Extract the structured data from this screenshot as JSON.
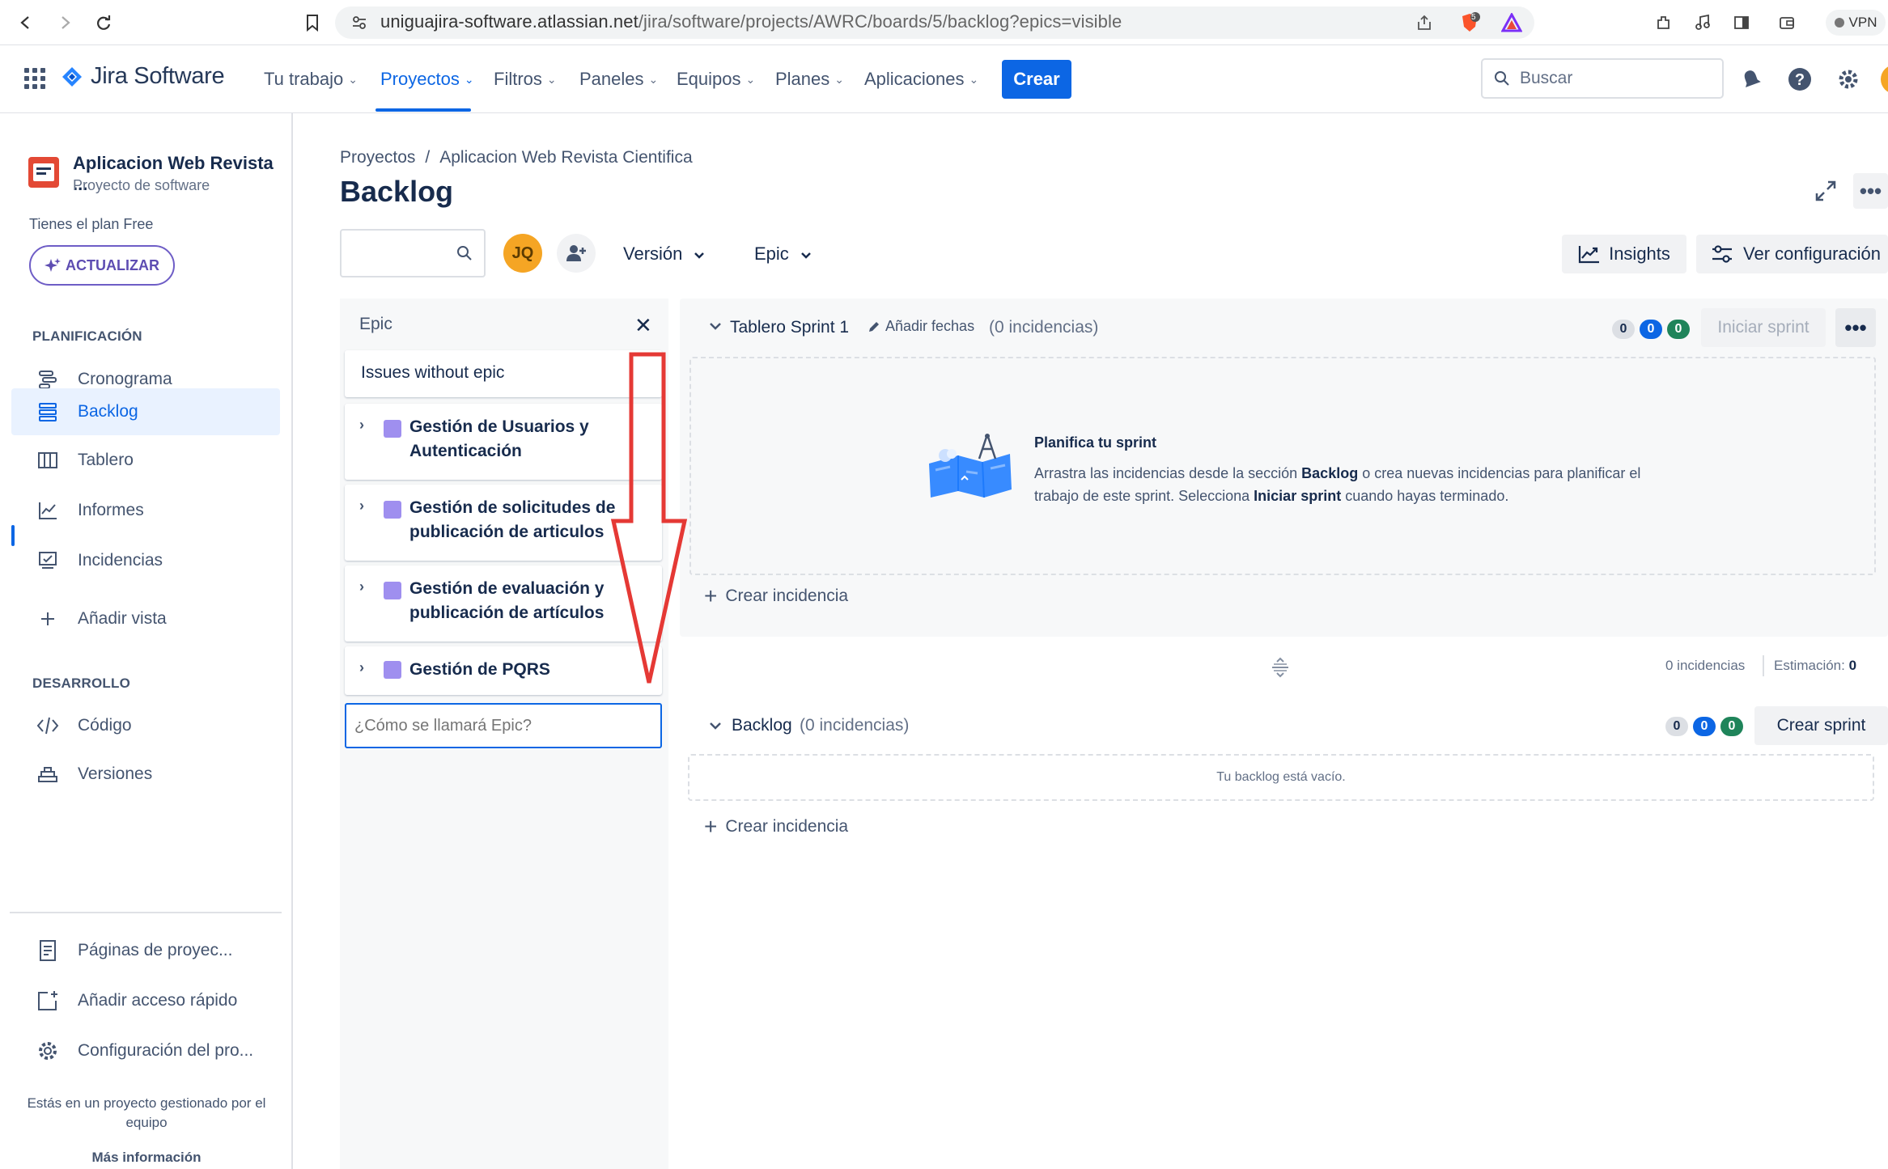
{
  "browser": {
    "url_domain": "uniguajira-software.atlassian.net",
    "url_path": "/jira/software/projects/AWRC/boards/5/backlog?epics=visible",
    "shield_badge": "5",
    "vpn_label": "VPN"
  },
  "topnav": {
    "product": "Jira Software",
    "items": [
      {
        "label": "Tu trabajo"
      },
      {
        "label": "Proyectos"
      },
      {
        "label": "Filtros"
      },
      {
        "label": "Paneles"
      },
      {
        "label": "Equipos"
      },
      {
        "label": "Planes"
      },
      {
        "label": "Aplicaciones"
      }
    ],
    "active_item": "Proyectos",
    "create_label": "Crear",
    "search_placeholder": "Buscar",
    "accent": "#0c66e4"
  },
  "sidebar": {
    "project_name": "Aplicacion Web Revista ...",
    "project_type": "Proyecto de software",
    "plan_text": "Tienes el plan Free",
    "upgrade_label": "ACTUALIZAR",
    "planning_section": "PLANIFICACIÓN",
    "planning_items": [
      {
        "label": "Cronograma",
        "icon": "timeline-icon"
      },
      {
        "label": "Backlog",
        "icon": "backlog-icon"
      },
      {
        "label": "Tablero",
        "icon": "board-icon"
      },
      {
        "label": "Informes",
        "icon": "reports-icon"
      },
      {
        "label": "Incidencias",
        "icon": "issues-icon"
      }
    ],
    "selected_item": "Backlog",
    "add_view_label": "Añadir vista",
    "dev_section": "DESARROLLO",
    "dev_items": [
      {
        "label": "Código",
        "icon": "code-icon"
      },
      {
        "label": "Versiones",
        "icon": "releases-icon"
      }
    ],
    "bottom_items": [
      {
        "label": "Páginas de proyec...",
        "icon": "pages-icon"
      },
      {
        "label": "Añadir acceso rápido",
        "icon": "add-shortcut-icon"
      },
      {
        "label": "Configuración del pro...",
        "icon": "settings-icon"
      }
    ],
    "footer_text": "Estás en un proyecto gestionado por el equipo",
    "more_info": "Más información"
  },
  "main": {
    "breadcrumb": [
      "Proyectos",
      "Aplicacion Web Revista Cientifica"
    ],
    "breadcrumb_sep": "/",
    "title": "Backlog",
    "avatar_initials": "JQ",
    "version_filter": "Versión",
    "epic_filter": "Epic",
    "insights_label": "Insights",
    "config_label": "Ver configuración"
  },
  "epic_panel": {
    "header": "Epic",
    "no_epic": "Issues without epic",
    "epics": [
      {
        "name": "Gestión de Usuarios y Autenticación",
        "color": "#9f8fef"
      },
      {
        "name": "Gestión de solicitudes de publicación de articulos",
        "color": "#9f8fef"
      },
      {
        "name": "Gestión de evaluación y publicación de artículos",
        "color": "#9f8fef"
      },
      {
        "name": "Gestión de PQRS",
        "color": "#9f8fef"
      }
    ],
    "input_placeholder": "¿Cómo se llamará Epic?"
  },
  "sprint": {
    "title": "Tablero Sprint 1",
    "add_dates": "Añadir fechas",
    "count": "(0 incidencias)",
    "todo": "0",
    "in_progress": "0",
    "done": "0",
    "start_label": "Iniciar sprint",
    "plan_title": "Planifica tu sprint",
    "plan_desc_1": "Arrastra las incidencias desde la sección ",
    "plan_desc_bold_1": "Backlog",
    "plan_desc_2": " o crea nuevas incidencias para planificar el trabajo de este sprint. Selecciona ",
    "plan_desc_bold_2": "Iniciar sprint",
    "plan_desc_3": " cuando hayas terminado.",
    "create_issue": "Crear incidencia"
  },
  "stats": {
    "issues": "0 incidencias",
    "estimate_label": "Estimación:",
    "estimate_value": "0"
  },
  "backlog": {
    "title": "Backlog",
    "count": "(0 incidencias)",
    "todo": "0",
    "in_progress": "0",
    "done": "0",
    "create_sprint": "Crear sprint",
    "empty_text": "Tu backlog está vacío.",
    "create_issue": "Crear incidencia"
  },
  "annotation": {
    "arrow_color": "#e53935"
  }
}
